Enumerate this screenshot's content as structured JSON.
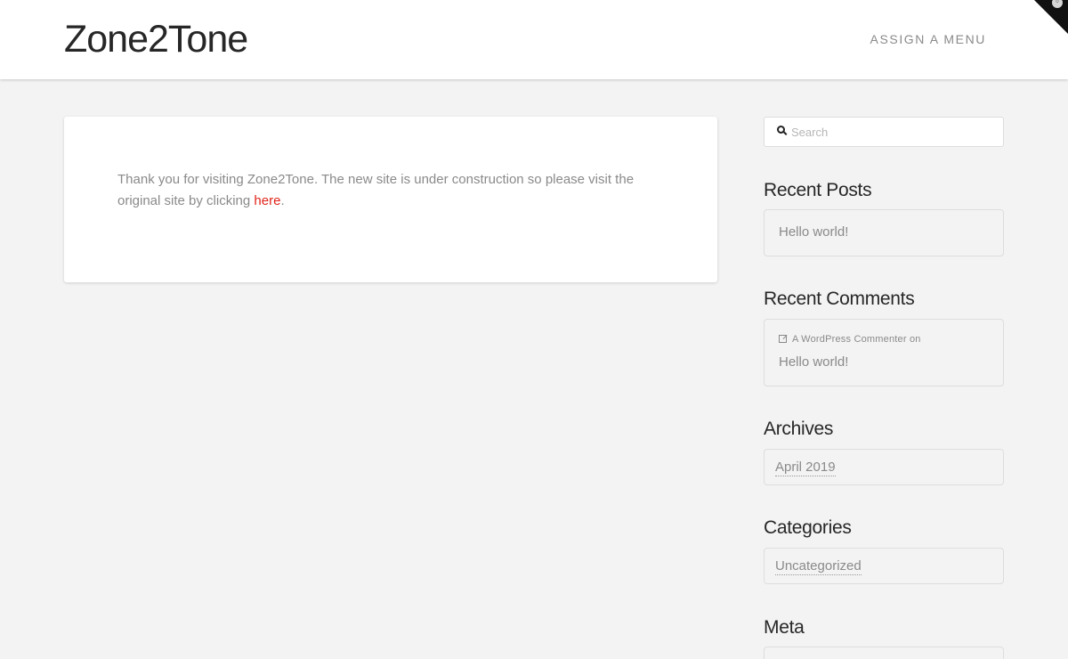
{
  "header": {
    "site_title": "Zone2Tone",
    "menu_label": "ASSIGN A MENU"
  },
  "entry": {
    "text_before": "Thank you for visiting Zone2Tone. The new site is under construction so please visit the original site by clicking ",
    "link_text": "here",
    "text_after": "."
  },
  "sidebar": {
    "search": {
      "placeholder": "Search",
      "value": ""
    },
    "recent_posts": {
      "title": "Recent Posts",
      "items": [
        "Hello world!"
      ]
    },
    "recent_comments": {
      "title": "Recent Comments",
      "author": "A WordPress Commenter",
      "connector": "on",
      "post": "Hello world!"
    },
    "archives": {
      "title": "Archives",
      "items": [
        "April 2019"
      ]
    },
    "categories": {
      "title": "Categories",
      "items": [
        "Uncategorized"
      ]
    },
    "meta": {
      "title": "Meta"
    }
  },
  "colors": {
    "background": "#f3f3f3",
    "accent_link": "#e0251b",
    "text_muted": "#8a8a8a",
    "title": "#272727"
  },
  "icons": {
    "search": "search-icon",
    "external": "external-link-icon",
    "corner": "admin-toggle-icon"
  }
}
